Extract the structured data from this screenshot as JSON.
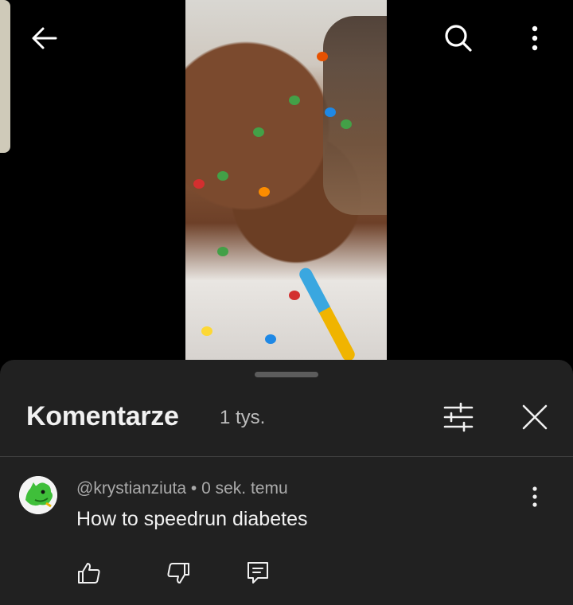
{
  "top_bar": {
    "back_icon": "arrow-left-icon",
    "search_icon": "search-icon",
    "more_icon": "more-vertical-icon"
  },
  "comments_panel": {
    "title": "Komentarze",
    "count": "1 tys.",
    "filter_icon": "sliders-icon",
    "close_icon": "close-icon"
  },
  "comments": [
    {
      "author": "@krystianziuta",
      "separator": "•",
      "time": "0 sek. temu",
      "text": "How to speedrun diabetes",
      "actions": [
        "thumb-up-icon",
        "thumb-down-icon",
        "reply-icon"
      ]
    }
  ],
  "colors": {
    "sheet_bg": "#212121",
    "text_primary": "#f1f1f1",
    "text_secondary": "#aaaaaa",
    "avatar_green": "#3fbf3a"
  }
}
